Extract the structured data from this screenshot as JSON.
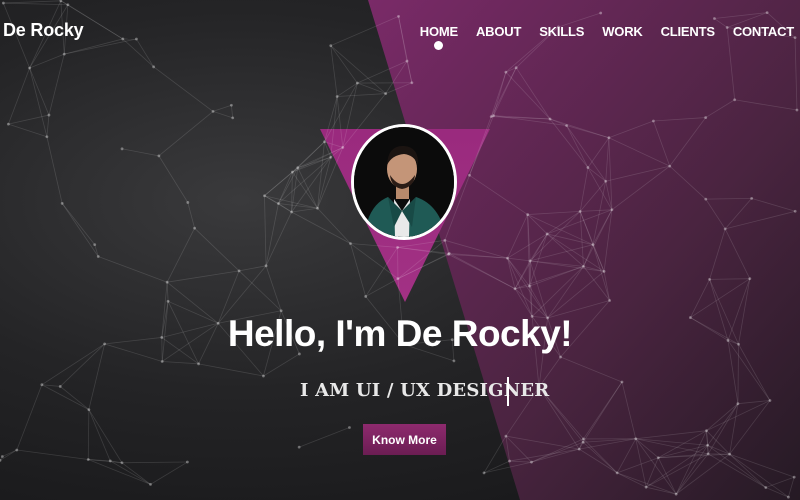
{
  "brand": {
    "name": "De Rocky"
  },
  "nav": {
    "items": [
      {
        "label": "HOME",
        "active": true
      },
      {
        "label": "ABOUT",
        "active": false
      },
      {
        "label": "SKILLS",
        "active": false
      },
      {
        "label": "WORK",
        "active": false
      },
      {
        "label": "CLIENTS",
        "active": false
      },
      {
        "label": "CONTACT",
        "active": false
      }
    ]
  },
  "hero": {
    "headline": "Hello, I'm De Rocky!",
    "subtitle": "I AM UI / UX DESIGNER",
    "cta_label": "Know More"
  },
  "theme": {
    "accent": "#8e2a6e",
    "background": "#242426",
    "text": "#ffffff"
  }
}
